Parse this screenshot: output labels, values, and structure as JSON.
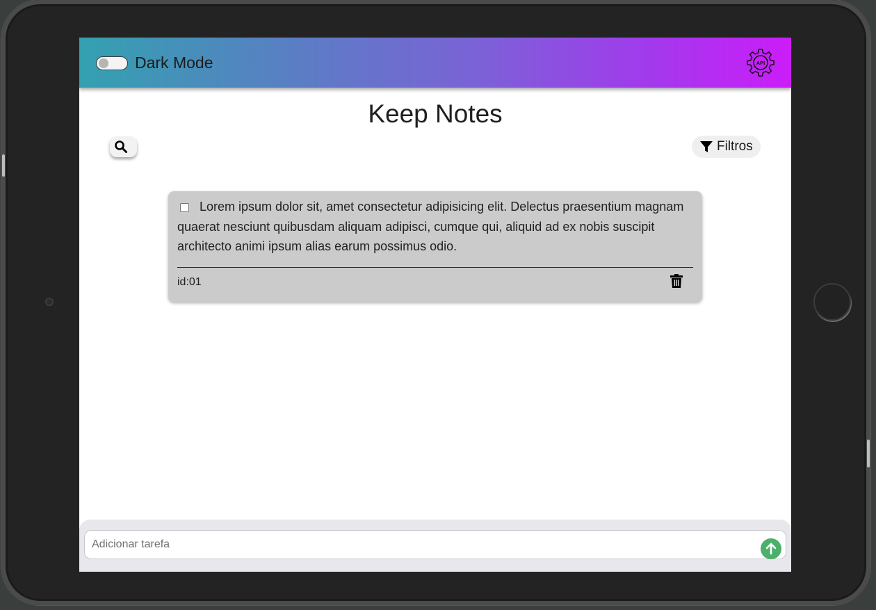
{
  "header": {
    "dark_mode_label": "Dark Mode",
    "dark_mode_enabled": false,
    "api_icon_text": "API"
  },
  "main": {
    "title": "Keep Notes",
    "filter_label": "Filtros"
  },
  "notes": [
    {
      "text": "Lorem ipsum dolor sit, amet consectetur adipisicing elit. Delectus praesentium magnam quaerat nesciunt quibusdam aliquam adipisci, cumque qui, aliquid ad ex nobis suscipit architecto animi ipsum alias earum possimus odio.",
      "id_label": "id:01",
      "checked": false
    }
  ],
  "composer": {
    "placeholder": "Adicionar tarefa",
    "value": ""
  },
  "colors": {
    "header_gradient_start": "#33a1b0",
    "header_gradient_end": "#cc1cf9",
    "note_background": "#cbcbcb",
    "send_button": "#4caf6a"
  },
  "icons": [
    "search-icon",
    "filter-icon",
    "api-gear-icon",
    "trash-icon",
    "arrow-up-icon"
  ]
}
